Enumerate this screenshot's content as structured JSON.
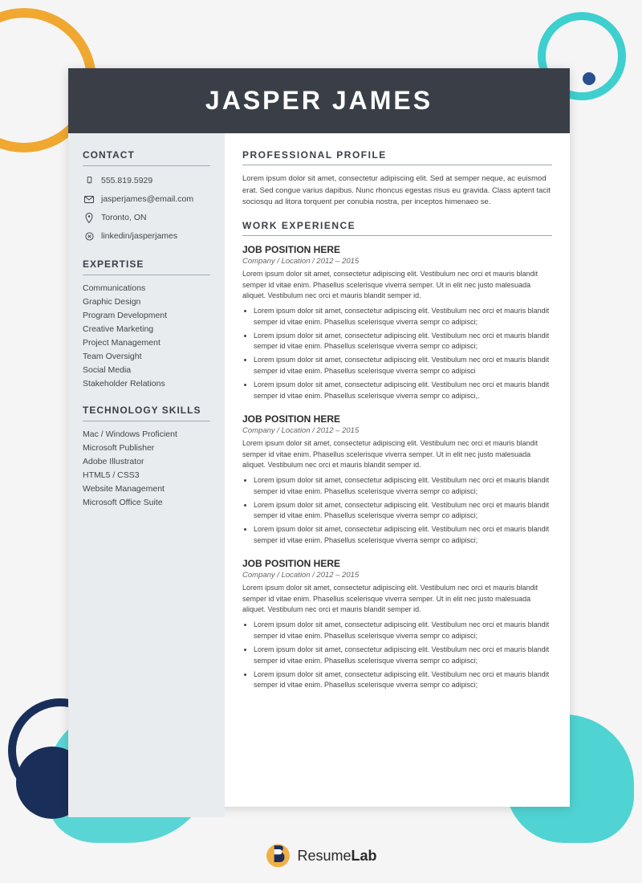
{
  "header": {
    "name": "JASPER JAMES"
  },
  "sidebar": {
    "contact_title": "CONTACT",
    "phone": "555.819.5929",
    "email": "jasperjames@email.com",
    "location": "Toronto, ON",
    "linkedin": "linkedin/jasperjames",
    "expertise_title": "EXPERTISE",
    "expertise_items": [
      "Communications",
      "Graphic Design",
      "Program Development",
      "Creative Marketing",
      "Project Management",
      "Team Oversight",
      "Social Media",
      "Stakeholder Relations"
    ],
    "tech_title": "TECHNOLOGY SKILLS",
    "tech_items": [
      "Mac / Windows Proficient",
      "Microsoft Publisher",
      "Adobe Illustrator",
      "HTML5 / CSS3",
      "Website Management",
      "Microsoft Office Suite"
    ]
  },
  "main": {
    "profile_title": "PROFESSIONAL PROFILE",
    "profile_text": "Lorem ipsum dolor sit amet, consectetur adipiscing elit. Sed at semper neque, ac euismod erat. Sed congue varius dapibus. Nunc rhoncus egestas risus eu gravida. Class aptent tacit sociosqu ad litora torquent per conubia nostra, per inceptos himenaeo se.",
    "work_title": "WORK EXPERIENCE",
    "jobs": [
      {
        "title": "JOB POSITION HERE",
        "meta": "Company / Location / 2012 – 2015",
        "desc": "Lorem ipsum dolor sit amet, consectetur adipiscing elit. Vestibulum nec orci et mauris blandit semper id vitae enim. Phasellus scelerisque viverra semper. Ut in elit nec justo malesuada aliquet. Vestibulum nec orci et mauris blandit semper id.",
        "bullets": [
          "Lorem ipsum dolor sit amet, consectetur adipiscing elit. Vestibulum nec orci et mauris blandit semper id vitae enim. Phasellus scelerisque viverra sempr co adipisci;",
          "Lorem ipsum dolor sit amet, consectetur adipiscing elit. Vestibulum nec orci et mauris blandit semper id vitae enim. Phasellus scelerisque viverra sempr co adipisci;",
          "Lorem ipsum dolor sit amet, consectetur adipiscing elit. Vestibulum nec orci et mauris blandit semper id vitae enim. Phasellus scelerisque viverra sempr co adipisci",
          "Lorem ipsum dolor sit amet, consectetur adipiscing elit. Vestibulum nec orci et mauris blandit semper id vitae enim. Phasellus scelerisque viverra sempr co adipisci,."
        ]
      },
      {
        "title": "JOB POSITION HERE",
        "meta": "Company / Location /  2012 – 2015",
        "desc": "Lorem ipsum dolor sit amet, consectetur adipiscing elit. Vestibulum nec orci et mauris blandit semper id vitae enim. Phasellus scelerisque viverra semper. Ut in elit nec justo malesuada aliquet. Vestibulum nec orci et mauris blandit semper id.",
        "bullets": [
          "Lorem ipsum dolor sit amet, consectetur adipiscing elit. Vestibulum nec orci et mauris blandit semper id vitae enim. Phasellus scelerisque viverra sempr co adipisci;",
          "Lorem ipsum dolor sit amet, consectetur adipiscing elit. Vestibulum nec orci et mauris blandit semper id vitae enim. Phasellus scelerisque viverra sempr co adipisci;",
          "Lorem ipsum dolor sit amet, consectetur adipiscing elit. Vestibulum nec orci et mauris blandit semper id vitae enim. Phasellus scelerisque viverra sempr co adipisci;"
        ]
      },
      {
        "title": "JOB POSITION HERE",
        "meta": "Company / Location / 2012 – 2015",
        "desc": "Lorem ipsum dolor sit amet, consectetur adipiscing elit. Vestibulum nec orci et mauris blandit semper id vitae enim. Phasellus scelerisque viverra semper. Ut in elit nec justo malesuada aliquet. Vestibulum nec orci et mauris blandit semper id.",
        "bullets": [
          "Lorem ipsum dolor sit amet, consectetur adipiscing elit. Vestibulum nec orci et mauris blandit semper id vitae enim. Phasellus scelerisque viverra sempr co adipisci;",
          "Lorem ipsum dolor sit amet, consectetur adipiscing elit. Vestibulum nec orci et mauris blandit semper id vitae enim. Phasellus scelerisque viverra sempr co adipisci;",
          "Lorem ipsum dolor sit amet, consectetur adipiscing elit. Vestibulum nec orci et mauris blandit semper id vitae enim. Phasellus scelerisque viverra sempr co adipisci;"
        ]
      }
    ]
  },
  "branding": {
    "name": "ResumeLab"
  }
}
